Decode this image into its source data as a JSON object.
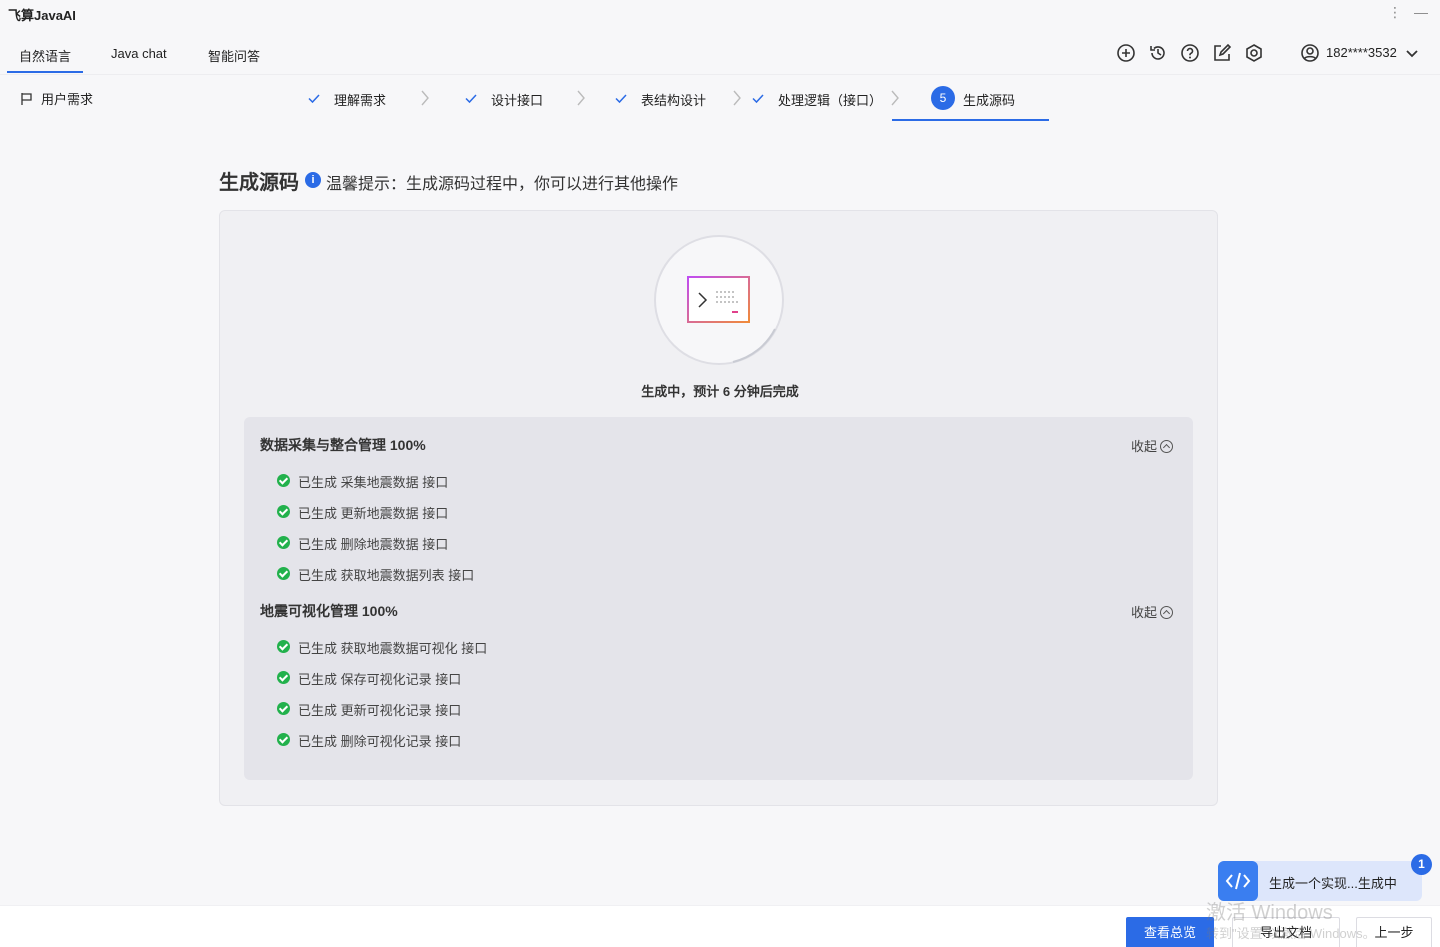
{
  "app": {
    "title": "飞算JavaAI"
  },
  "tabs": [
    {
      "label": "自然语言",
      "active": true
    },
    {
      "label": "Java chat",
      "active": false
    },
    {
      "label": "智能问答",
      "active": false
    }
  ],
  "toolbar_icons": [
    "add-icon",
    "history-icon",
    "help-icon",
    "edit-icon",
    "settings-icon"
  ],
  "user": {
    "name": "182****3532"
  },
  "requirement_link": "用户需求",
  "steps": [
    {
      "label": "理解需求",
      "state": "done"
    },
    {
      "label": "设计接口",
      "state": "done"
    },
    {
      "label": "表结构设计",
      "state": "done"
    },
    {
      "label": "处理逻辑（接口）",
      "state": "done"
    },
    {
      "number": "5",
      "label": "生成源码",
      "state": "active"
    }
  ],
  "heading": {
    "title": "生成源码",
    "tip": "温馨提示：生成源码过程中，你可以进行其他操作"
  },
  "status": "生成中，预计 6 分钟后完成",
  "collapse_label": "收起",
  "groups": [
    {
      "title": "数据采集与整合管理 100%",
      "items": [
        "已生成 采集地震数据 接口",
        "已生成 更新地震数据 接口",
        "已生成 删除地震数据 接口",
        "已生成 获取地震数据列表 接口"
      ]
    },
    {
      "title": "地震可视化管理 100%",
      "items": [
        "已生成 获取地震数据可视化 接口",
        "已生成 保存可视化记录 接口",
        "已生成 更新可视化记录 接口",
        "已生成 删除可视化记录 接口"
      ]
    }
  ],
  "float_task": {
    "text": "生成一个实现...生成中",
    "badge": "1"
  },
  "watermark": {
    "line1": "激活 Windows",
    "line2": "转到\"设置\"以激活 Windows。"
  },
  "bottom_buttons": {
    "overview": "查看总览",
    "export": "导出文档",
    "prev": "上一步"
  },
  "colors": {
    "accent": "#2b6be6",
    "success": "#22b14c"
  }
}
